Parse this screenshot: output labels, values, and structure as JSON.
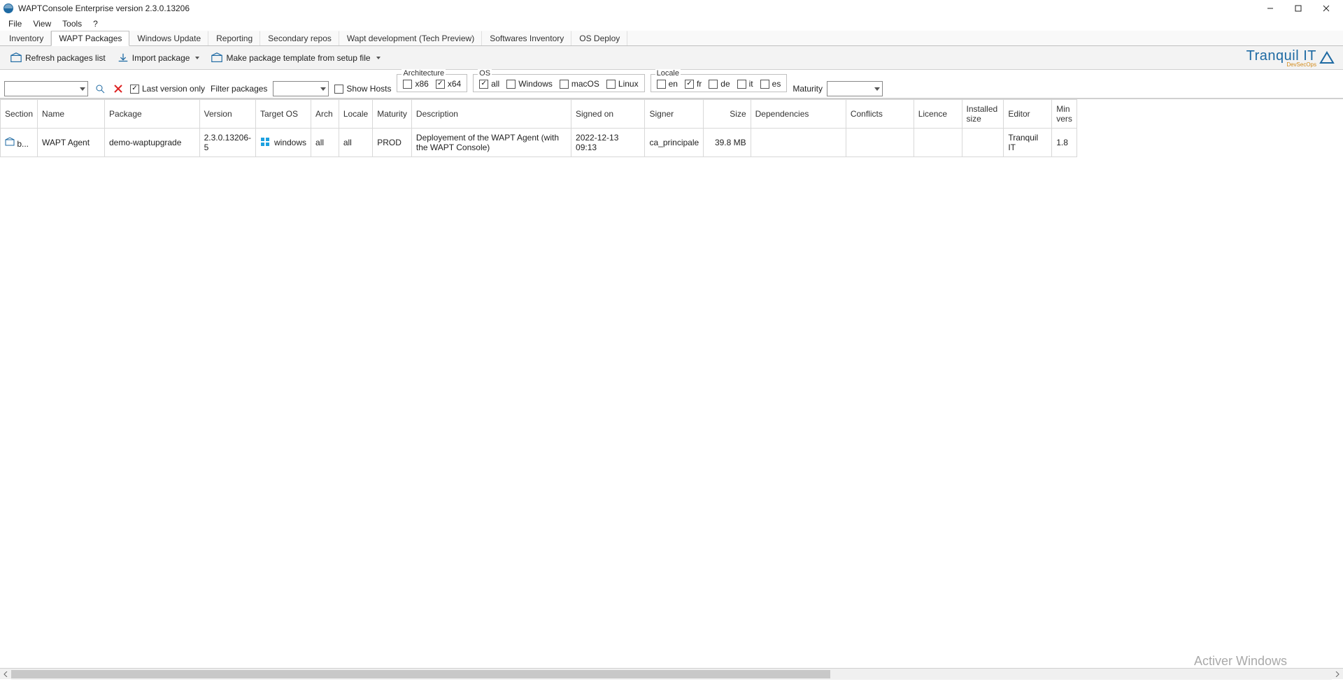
{
  "window": {
    "title": "WAPTConsole Enterprise version 2.3.0.13206"
  },
  "menubar": [
    "File",
    "View",
    "Tools",
    "?"
  ],
  "tabs": [
    {
      "label": "Inventory"
    },
    {
      "label": "WAPT Packages",
      "active": true
    },
    {
      "label": "Windows Update"
    },
    {
      "label": "Reporting"
    },
    {
      "label": "Secondary repos"
    },
    {
      "label": "Wapt development (Tech Preview)"
    },
    {
      "label": "Softwares Inventory"
    },
    {
      "label": "OS Deploy"
    }
  ],
  "toolbar": {
    "refresh": "Refresh packages list",
    "import": "Import package",
    "make_template": "Make package template from setup file"
  },
  "brand": {
    "name": "Tranquil IT",
    "sub": "DevSecOps"
  },
  "filters": {
    "last_version_only": {
      "label": "Last version only",
      "checked": true
    },
    "filter_packages_label": "Filter packages",
    "show_hosts": {
      "label": "Show Hosts",
      "checked": false
    },
    "architecture": {
      "legend": "Architecture",
      "items": [
        {
          "label": "x86",
          "checked": false
        },
        {
          "label": "x64",
          "checked": true
        }
      ]
    },
    "os": {
      "legend": "OS",
      "items": [
        {
          "label": "all",
          "checked": true
        },
        {
          "label": "Windows",
          "checked": false
        },
        {
          "label": "macOS",
          "checked": false
        },
        {
          "label": "Linux",
          "checked": false
        }
      ]
    },
    "locale": {
      "legend": "Locale",
      "items": [
        {
          "label": "en",
          "checked": false
        },
        {
          "label": "fr",
          "checked": true
        },
        {
          "label": "de",
          "checked": false
        },
        {
          "label": "it",
          "checked": false
        },
        {
          "label": "es",
          "checked": false
        }
      ]
    },
    "maturity_label": "Maturity"
  },
  "columns": [
    "Section",
    "Name",
    "Package",
    "Version",
    "Target OS",
    "Arch",
    "Locale",
    "Maturity",
    "Description",
    "Signed on",
    "Signer",
    "Size",
    "Dependencies",
    "Conflicts",
    "Licence",
    "Installed size",
    "Editor",
    "Min vers"
  ],
  "rows": [
    {
      "section": "b...",
      "name": "WAPT Agent",
      "package": "demo-waptupgrade",
      "version": "2.3.0.13206-5",
      "target_os": "windows",
      "arch": "all",
      "locale": "all",
      "maturity": "PROD",
      "description": "Deployement of the WAPT Agent (with the WAPT Console)",
      "signed_on": "2022-12-13 09:13",
      "signer": "ca_principale",
      "size": "39.8 MB",
      "dependencies": "",
      "conflicts": "",
      "licence": "",
      "installed_size": "",
      "editor": "Tranquil IT",
      "min_vers": "1.8"
    }
  ],
  "watermark": "Activer Windows"
}
